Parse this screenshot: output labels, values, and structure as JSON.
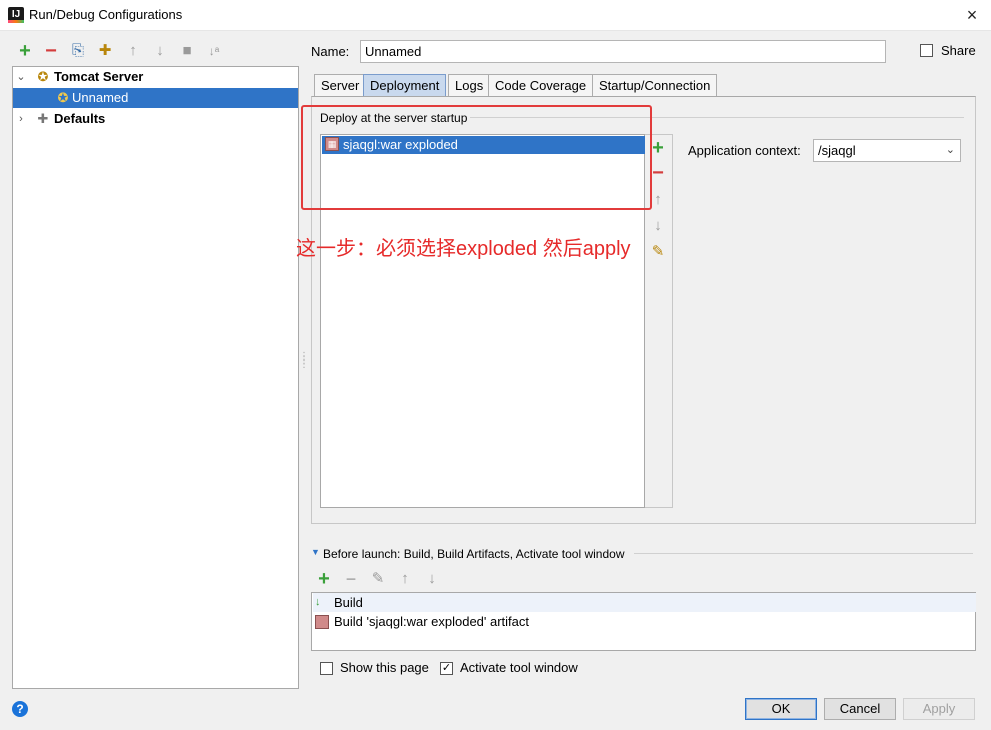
{
  "window": {
    "title": "Run/Debug Configurations",
    "close_icon": "×"
  },
  "toolbar": {
    "add": "+",
    "remove": "−",
    "copy": "⎘",
    "wrench": "✚",
    "up": "↑",
    "down": "↓",
    "folder": "■",
    "sort": "↓ᵃ"
  },
  "tree": {
    "items": [
      {
        "label": "Tomcat Server",
        "expanded": true
      },
      {
        "label": "Unnamed",
        "selected": true
      },
      {
        "label": "Defaults",
        "expanded": false
      }
    ]
  },
  "name": {
    "label": "Name:",
    "value": "Unnamed"
  },
  "share": {
    "label": "Share"
  },
  "tabs": [
    {
      "label": "Server"
    },
    {
      "label": "Deployment",
      "active": true
    },
    {
      "label": "Logs"
    },
    {
      "label": "Code Coverage"
    },
    {
      "label": "Startup/Connection"
    }
  ],
  "deploy": {
    "section_label": "Deploy at the server startup",
    "items": [
      {
        "label": "sjaqgl:war exploded",
        "selected": true
      }
    ],
    "side_buttons": {
      "add": "+",
      "remove": "−",
      "up": "↑",
      "down": "↓",
      "edit": "✎"
    },
    "annotation": "这一步：必须选择exploded  然后apply",
    "annotation_color": "#e62a2a"
  },
  "context": {
    "label": "Application context:",
    "value": "/sjaqgl"
  },
  "before_launch": {
    "header": "Before launch: Build, Build Artifacts, Activate tool window",
    "toolbar": {
      "add": "+",
      "remove": "−",
      "edit": "✎",
      "up": "↑",
      "down": "↓"
    },
    "items": [
      {
        "label": "Build"
      },
      {
        "label": "Build 'sjaqgl:war exploded' artifact"
      }
    ]
  },
  "options": {
    "show_page": {
      "label": "Show this page",
      "checked": false
    },
    "activate_tool": {
      "label": "Activate tool window",
      "checked": true
    }
  },
  "buttons": {
    "ok": "OK",
    "cancel": "Cancel",
    "apply": "Apply"
  },
  "help": "?",
  "colors": {
    "selection": "#2f74c7",
    "accent_green": "#3aa03a",
    "accent_red": "#d43d3d"
  }
}
